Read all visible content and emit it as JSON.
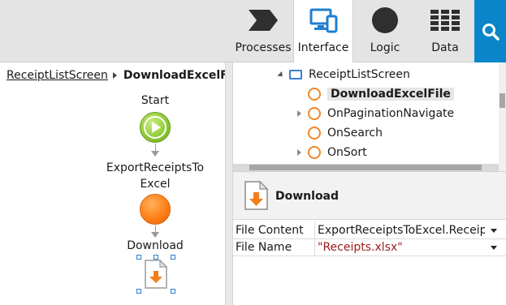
{
  "toolbar": {
    "tabs": [
      {
        "label": "Processes",
        "icon": "processes-chevron-icon"
      },
      {
        "label": "Interface",
        "icon": "interface-devices-icon",
        "active": true
      },
      {
        "label": "Logic",
        "icon": "logic-circle-icon"
      },
      {
        "label": "Data",
        "icon": "data-grid-icon"
      }
    ],
    "search_icon": "search-icon",
    "accent_color": "#0A85C9"
  },
  "breadcrumb": {
    "parent": "ReceiptListScreen",
    "current": "DownloadExcelFile"
  },
  "flow": {
    "start_label": "Start",
    "action_label_line1": "ExportReceiptsTo",
    "action_label_line2": "Excel",
    "download_label": "Download",
    "start_color": "#8ECB35",
    "action_color": "#FF7F16"
  },
  "tree": {
    "root": "ReceiptListScreen",
    "items": [
      {
        "label": "DownloadExcelFile",
        "selected": true,
        "expandable": false
      },
      {
        "label": "OnPaginationNavigate",
        "expandable": true
      },
      {
        "label": "OnSearch",
        "expandable": false
      },
      {
        "label": "OnSort",
        "expandable": true
      }
    ]
  },
  "properties": {
    "title": "Download",
    "rows": [
      {
        "name": "File Content",
        "value": "ExportReceiptsToExcel.Receipts"
      },
      {
        "name": "File Name",
        "value": "\"Receipts.xlsx\""
      }
    ]
  }
}
